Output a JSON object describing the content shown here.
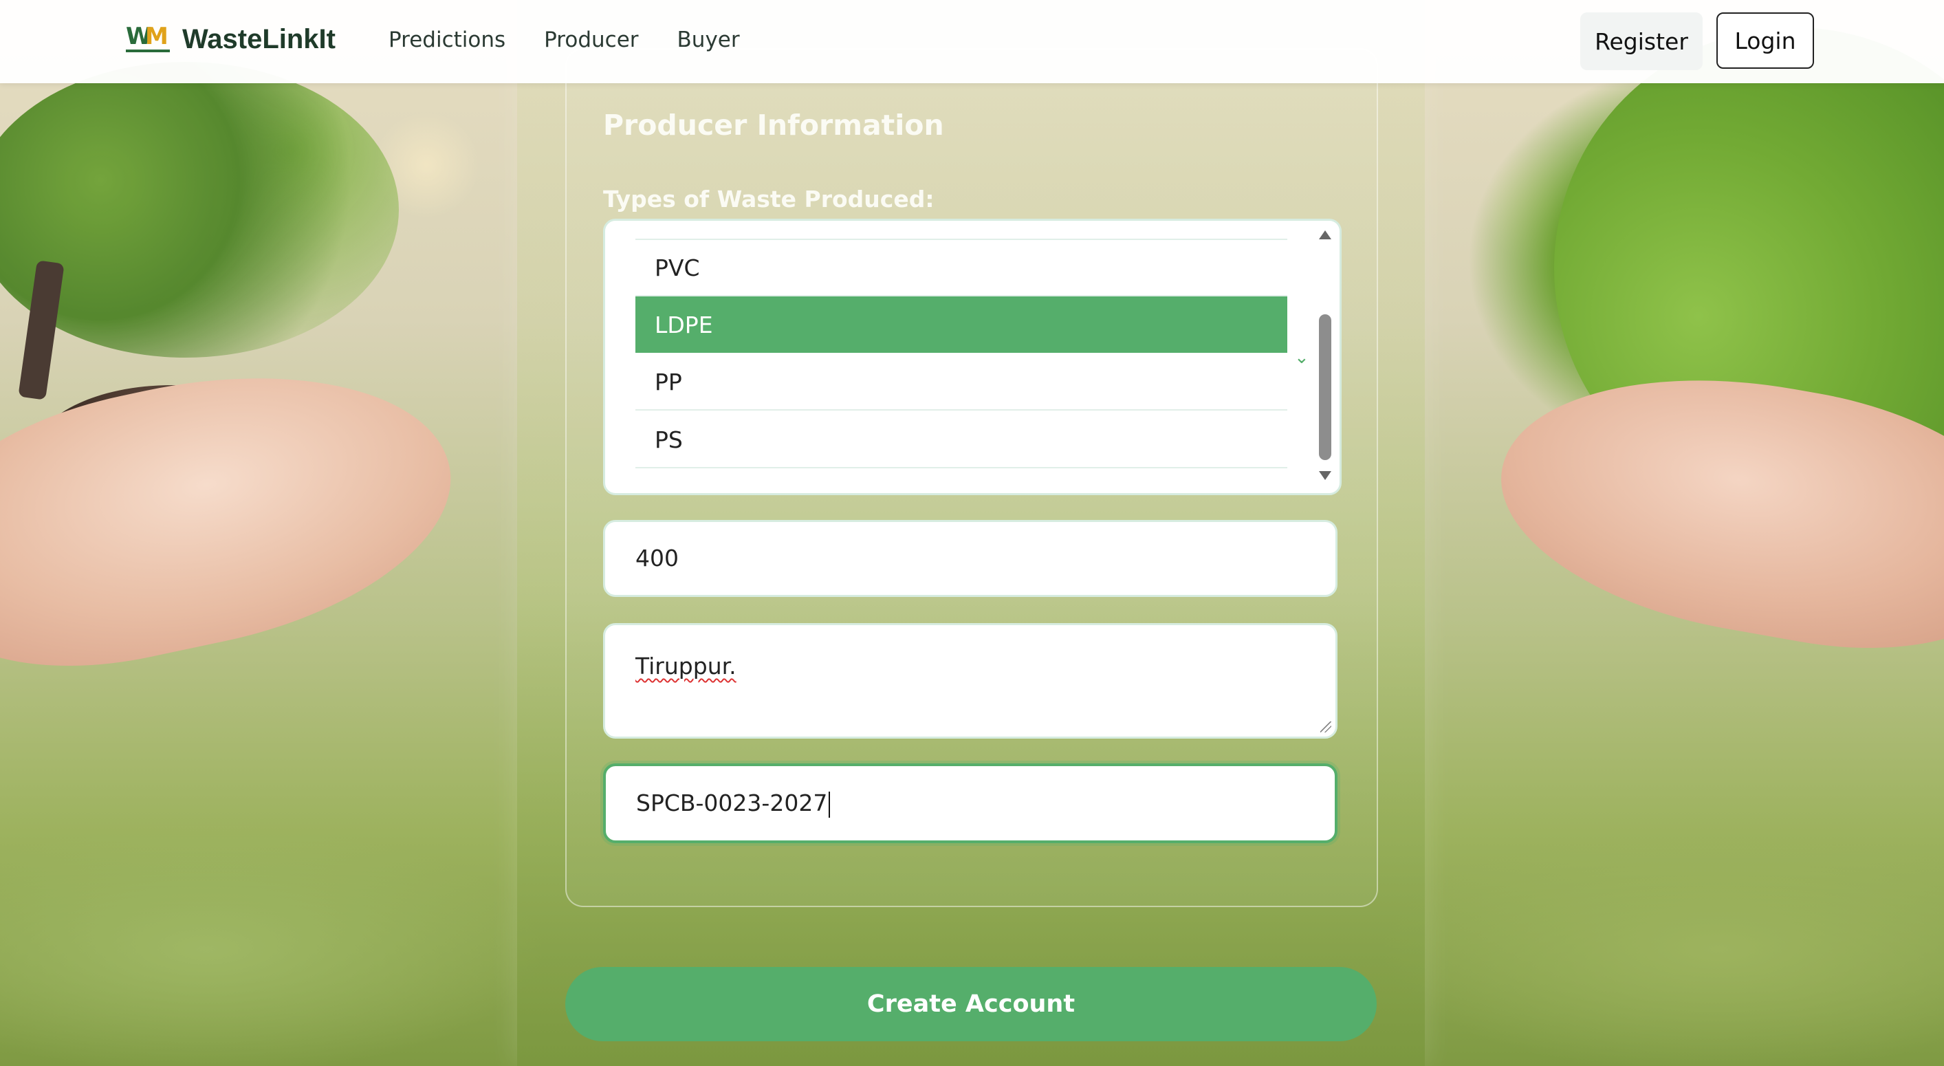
{
  "brand": {
    "logo_text_w": "W",
    "logo_text_m": "M",
    "name": "WasteLinkIt"
  },
  "nav": {
    "links": [
      "Predictions",
      "Producer",
      "Buyer"
    ],
    "register": "Register",
    "login": "Login"
  },
  "form": {
    "section_title": "Producer Information",
    "waste_label": "Types of Waste Produced:",
    "waste_options": [
      {
        "label": "PVC",
        "selected": false
      },
      {
        "label": "LDPE",
        "selected": true
      },
      {
        "label": "PP",
        "selected": false
      },
      {
        "label": "PS",
        "selected": false
      }
    ],
    "quantity_value": "400",
    "address_value": "Tiruppur.",
    "license_value": "SPCB-0023-2027",
    "submit_label": "Create Account"
  },
  "colors": {
    "accent": "#55ae6b",
    "text_dark": "#222222",
    "card_title": "#fbfbf4"
  },
  "icons": [
    "scroll-up-arrow-icon",
    "scroll-down-arrow-icon",
    "chevron-down-icon",
    "resize-handle-icon"
  ]
}
